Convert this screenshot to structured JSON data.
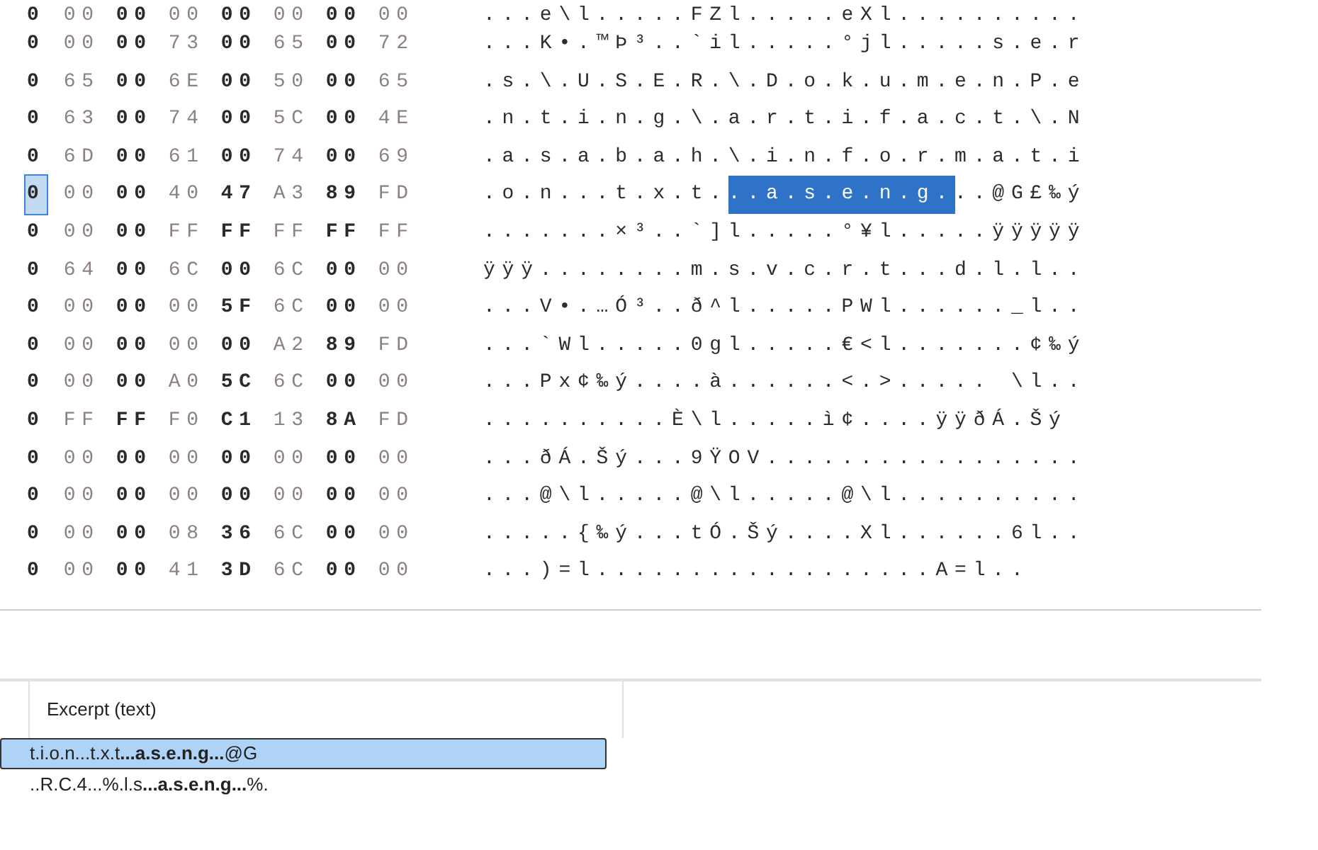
{
  "hex_view": {
    "rows": [
      {
        "first_byte_selected": false,
        "hex": [
          "0",
          "00",
          "00",
          "00",
          "00",
          "00",
          "00",
          "00"
        ],
        "ascii": [
          {
            "text": "...e\\l.....FZl.....eXl..........",
            "selected": false
          }
        ]
      },
      {
        "first_byte_selected": false,
        "hex": [
          "0",
          "00",
          "00",
          "73",
          "00",
          "65",
          "00",
          "72"
        ],
        "ascii": [
          {
            "text": "...K•.™Þ³..`il.....°jl.....s.e.r",
            "selected": false
          }
        ]
      },
      {
        "first_byte_selected": false,
        "hex": [
          "0",
          "65",
          "00",
          "6E",
          "00",
          "50",
          "00",
          "65"
        ],
        "ascii": [
          {
            "text": ".s.\\.U.S.E.R.\\.D.o.k.u.m.e.n.P.e",
            "selected": false
          }
        ]
      },
      {
        "first_byte_selected": false,
        "hex": [
          "0",
          "63",
          "00",
          "74",
          "00",
          "5C",
          "00",
          "4E"
        ],
        "ascii": [
          {
            "text": ".n.t.i.n.g.\\.a.r.t.i.f.a.c.t.\\.N",
            "selected": false
          }
        ]
      },
      {
        "first_byte_selected": false,
        "hex": [
          "0",
          "6D",
          "00",
          "61",
          "00",
          "74",
          "00",
          "69"
        ],
        "ascii": [
          {
            "text": ".a.s.a.b.a.h.\\.i.n.f.o.r.m.a.t.i",
            "selected": false
          }
        ]
      },
      {
        "first_byte_selected": true,
        "hex": [
          "0",
          "00",
          "00",
          "40",
          "47",
          "A3",
          "89",
          "FD"
        ],
        "ascii": [
          {
            "text": ".o.n...t.x.t.",
            "selected": false
          },
          {
            "text": "..a.s.e.n.g.",
            "selected": true
          },
          {
            "text": "..@G£‰ý",
            "selected": false
          }
        ]
      },
      {
        "first_byte_selected": false,
        "hex": [
          "0",
          "00",
          "00",
          "FF",
          "FF",
          "FF",
          "FF",
          "FF"
        ],
        "ascii": [
          {
            "text": ".......×³..`]l.....°¥l.....ÿÿÿÿÿ",
            "selected": false
          }
        ]
      },
      {
        "first_byte_selected": false,
        "hex": [
          "0",
          "64",
          "00",
          "6C",
          "00",
          "6C",
          "00",
          "00"
        ],
        "ascii": [
          {
            "text": "ÿÿÿ........m.s.v.c.r.t...d.l.l..",
            "selected": false
          }
        ]
      },
      {
        "first_byte_selected": false,
        "hex": [
          "0",
          "00",
          "00",
          "00",
          "5F",
          "6C",
          "00",
          "00"
        ],
        "ascii": [
          {
            "text": "...V•.…Ó³..ð^l.....PWl......_l..",
            "selected": false
          }
        ]
      },
      {
        "first_byte_selected": false,
        "hex": [
          "0",
          "00",
          "00",
          "00",
          "00",
          "A2",
          "89",
          "FD"
        ],
        "ascii": [
          {
            "text": "...`Wl.....0gl.....€<l.......¢‰ý",
            "selected": false
          }
        ]
      },
      {
        "first_byte_selected": false,
        "hex": [
          "0",
          "00",
          "00",
          "A0",
          "5C",
          "6C",
          "00",
          "00"
        ],
        "ascii": [
          {
            "text": "...Px¢‰ý....à......<.>..... \\l..",
            "selected": false
          }
        ]
      },
      {
        "first_byte_selected": false,
        "hex": [
          "0",
          "FF",
          "FF",
          "F0",
          "C1",
          "13",
          "8A",
          "FD"
        ],
        "ascii": [
          {
            "text": "..........È\\l.....ì¢....ÿÿðÁ.Šý",
            "selected": false
          }
        ]
      },
      {
        "first_byte_selected": false,
        "hex": [
          "0",
          "00",
          "00",
          "00",
          "00",
          "00",
          "00",
          "00"
        ],
        "ascii": [
          {
            "text": "...ðÁ.Šý...9ŸOV.................",
            "selected": false
          }
        ]
      },
      {
        "first_byte_selected": false,
        "hex": [
          "0",
          "00",
          "00",
          "00",
          "00",
          "00",
          "00",
          "00"
        ],
        "ascii": [
          {
            "text": "...@\\l.....@\\l.....@\\l..........",
            "selected": false
          }
        ]
      },
      {
        "first_byte_selected": false,
        "hex": [
          "0",
          "00",
          "00",
          "08",
          "36",
          "6C",
          "00",
          "00"
        ],
        "ascii": [
          {
            "text": ".....{‰ý...tÓ.Šý....Xl......6l..",
            "selected": false
          }
        ]
      },
      {
        "first_byte_selected": false,
        "hex": [
          "0",
          "00",
          "00",
          "41",
          "3D",
          "6C",
          "00",
          "00"
        ],
        "ascii": [
          {
            "text": "...)=l..................A=l..",
            "selected": false
          }
        ]
      }
    ]
  },
  "results_table": {
    "columns": [
      "Excerpt (text)"
    ],
    "rows": [
      {
        "excerpt": "t.i.o.n...t.x.t**...a.s.e.n.g...**@G",
        "selected": true
      },
      {
        "excerpt": "..R.C.4...%.l.s**...a.s.e.n.g...**%.",
        "selected": false
      }
    ]
  }
}
